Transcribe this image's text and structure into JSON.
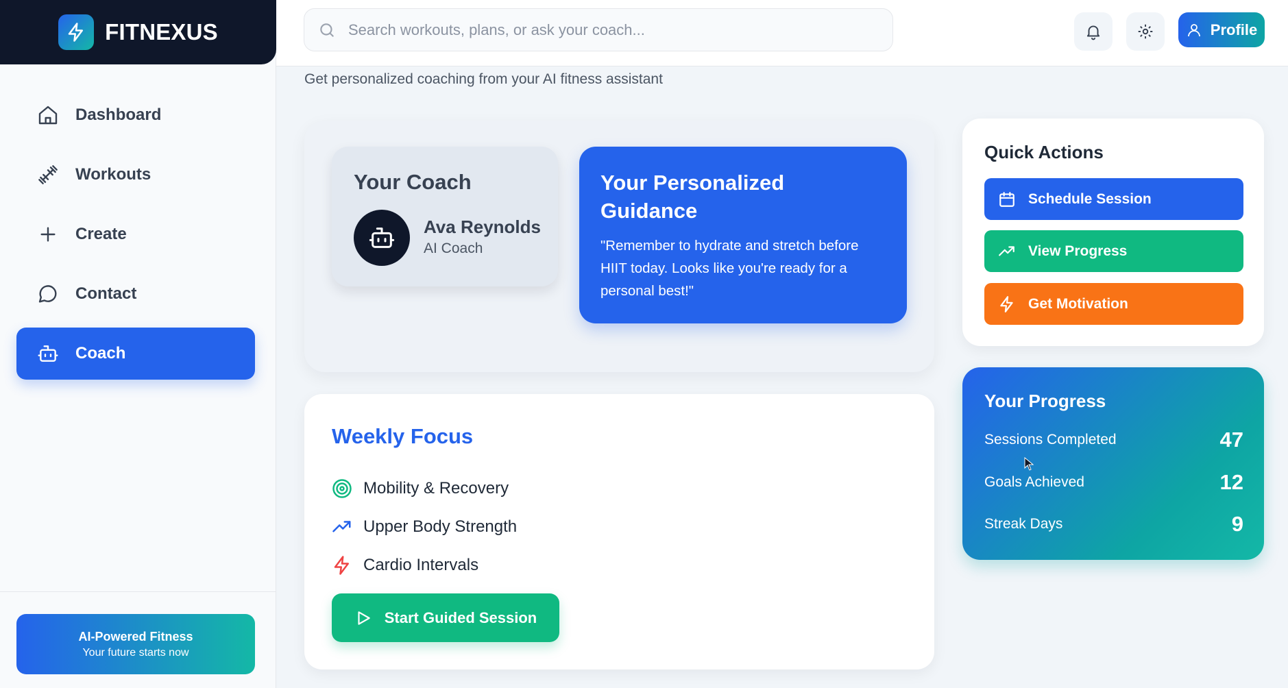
{
  "brand": {
    "name": "FITNEXUS"
  },
  "sidebar": {
    "items": [
      {
        "label": "Dashboard",
        "icon": "home-icon"
      },
      {
        "label": "Workouts",
        "icon": "dumbbell-icon"
      },
      {
        "label": "Create",
        "icon": "plus-icon"
      },
      {
        "label": "Contact",
        "icon": "message-circle-icon"
      },
      {
        "label": "Coach",
        "icon": "bot-icon",
        "active": true
      }
    ],
    "promo": {
      "title": "AI-Powered Fitness",
      "subtitle": "Your future starts now"
    }
  },
  "header": {
    "search_placeholder": "Search workouts, plans, or ask your coach...",
    "profile_label": "Profile",
    "subtitle": "Get personalized coaching from your AI fitness assistant"
  },
  "coach": {
    "card_title": "Your Coach",
    "name": "Ava Reynolds",
    "role": "AI Coach"
  },
  "guidance": {
    "title": "Your Personalized Guidance",
    "text": "\"Remember to hydrate and stretch before HIIT today. Looks like you're ready for a personal best!\""
  },
  "weekly_focus": {
    "title": "Weekly Focus",
    "items": [
      {
        "label": "Mobility & Recovery",
        "icon": "target-icon",
        "color": "#10b981"
      },
      {
        "label": "Upper Body Strength",
        "icon": "trending-up-icon",
        "color": "#2563eb"
      },
      {
        "label": "Cardio Intervals",
        "icon": "zap-icon",
        "color": "#ef4444"
      }
    ],
    "button_label": "Start Guided Session"
  },
  "quick_actions": {
    "title": "Quick Actions",
    "buttons": [
      {
        "label": "Schedule Session",
        "icon": "calendar-icon",
        "color": "#2563eb"
      },
      {
        "label": "View Progress",
        "icon": "trending-up-icon",
        "color": "#10b981"
      },
      {
        "label": "Get Motivation",
        "icon": "zap-icon",
        "color": "#f97316"
      }
    ]
  },
  "progress": {
    "title": "Your Progress",
    "stats": [
      {
        "label": "Sessions Completed",
        "value": "47"
      },
      {
        "label": "Goals Achieved",
        "value": "12"
      },
      {
        "label": "Streak Days",
        "value": "9"
      }
    ]
  },
  "colors": {
    "primary": "#2563eb",
    "success": "#10b981",
    "warning": "#f97316",
    "sidebar_dark": "#0f172a"
  }
}
